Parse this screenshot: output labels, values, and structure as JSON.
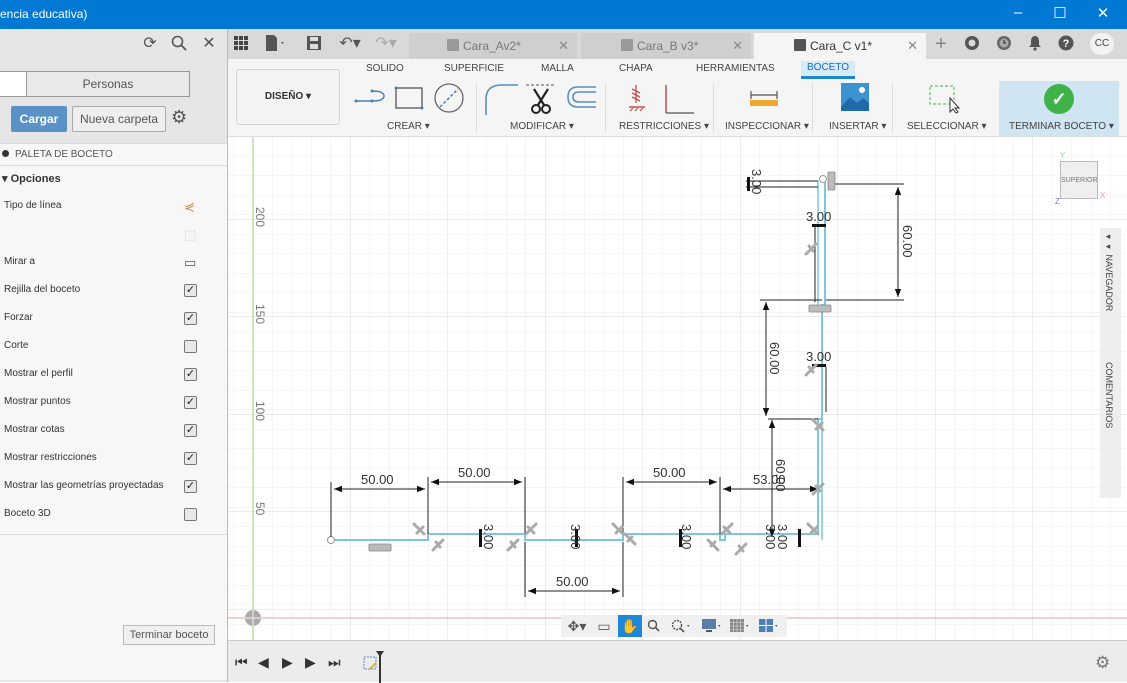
{
  "window": {
    "title": "encia educativa)",
    "minimize": "–",
    "maximize": "☐",
    "close": "✕"
  },
  "toolbar": {
    "left_icons": [
      "refresh-icon",
      "search-icon",
      "close-icon"
    ],
    "app_icons": [
      "grid-icon",
      "file-icon",
      "save-icon",
      "undo-icon",
      "redo-icon"
    ],
    "right_icons": [
      "add-tab-icon",
      "extensions-icon",
      "job-status-icon",
      "notifications-icon",
      "help-icon"
    ],
    "avatar": "CC"
  },
  "tabs": [
    {
      "label": "Cara_Av2*",
      "active": false
    },
    {
      "label": "Cara_B v3*",
      "active": false
    },
    {
      "label": "Cara_C v1*",
      "active": true
    }
  ],
  "left_panel": {
    "people_tab": "Personas",
    "upload_button": "Cargar",
    "new_folder_button": "Nueva carpeta",
    "palette_title": "PALETA DE BOCETO",
    "options_header": "Opciones",
    "options": [
      {
        "label": "Tipo de línea",
        "control": "icon",
        "icon": "linetype-icon"
      },
      {
        "label": "",
        "control": "icon",
        "icon": "construction-icon"
      },
      {
        "label": "Mirar a",
        "control": "icon",
        "icon": "look-at-icon"
      },
      {
        "label": "Rejilla del boceto",
        "control": "checkbox",
        "checked": true
      },
      {
        "label": "Forzar",
        "control": "checkbox",
        "checked": true
      },
      {
        "label": "Corte",
        "control": "checkbox",
        "checked": false
      },
      {
        "label": "Mostrar el perfil",
        "control": "checkbox",
        "checked": true
      },
      {
        "label": "Mostrar puntos",
        "control": "checkbox",
        "checked": true
      },
      {
        "label": "Mostrar cotas",
        "control": "checkbox",
        "checked": true
      },
      {
        "label": "Mostrar restricciones",
        "control": "checkbox",
        "checked": true
      },
      {
        "label": "Mostrar las geometrías proyectadas",
        "control": "checkbox",
        "checked": true
      },
      {
        "label": "Boceto 3D",
        "control": "checkbox",
        "checked": false
      }
    ],
    "finish_sketch_button": "Terminar boceto"
  },
  "ribbon": {
    "workspace": "DISEÑO",
    "tabs": [
      "SOLIDO",
      "SUPERFICIE",
      "MALLA",
      "CHAPA",
      "HERRAMIENTAS",
      "BOCETO"
    ],
    "active_tab": "BOCETO",
    "groups": [
      "CREAR",
      "MODIFICAR",
      "RESTRICCIONES",
      "INSPECCIONAR",
      "INSERTAR",
      "SELECCIONAR",
      "TERMINAR BOCETO"
    ]
  },
  "canvas": {
    "ruler_labels": [
      "200",
      "150",
      "100",
      "50"
    ],
    "view_cube_label": "SUPERIOR",
    "axis_labels": {
      "x": "X",
      "y": "Y",
      "z": "Z"
    },
    "dimensions": {
      "d1": "50.00",
      "d2": "50.00",
      "d3": "50.00",
      "d4": "50.00",
      "d5": "53.00",
      "t1": "3.00",
      "t2": "3.00",
      "t3": "3.00",
      "t4": "3.00",
      "t5": "3.00",
      "t6": "3.00",
      "t7": "3.00",
      "t8": "3.00",
      "v1": "60.00",
      "v2": "60.00",
      "v3": "60.00"
    },
    "side_panels": [
      "NAVEGADOR",
      "COMENTARIOS"
    ]
  },
  "colors": {
    "title_bar": "#0178d4",
    "accent": "#1e88d6",
    "sketch_line": "#7fc4e0",
    "finish_check": "#40b24a"
  }
}
